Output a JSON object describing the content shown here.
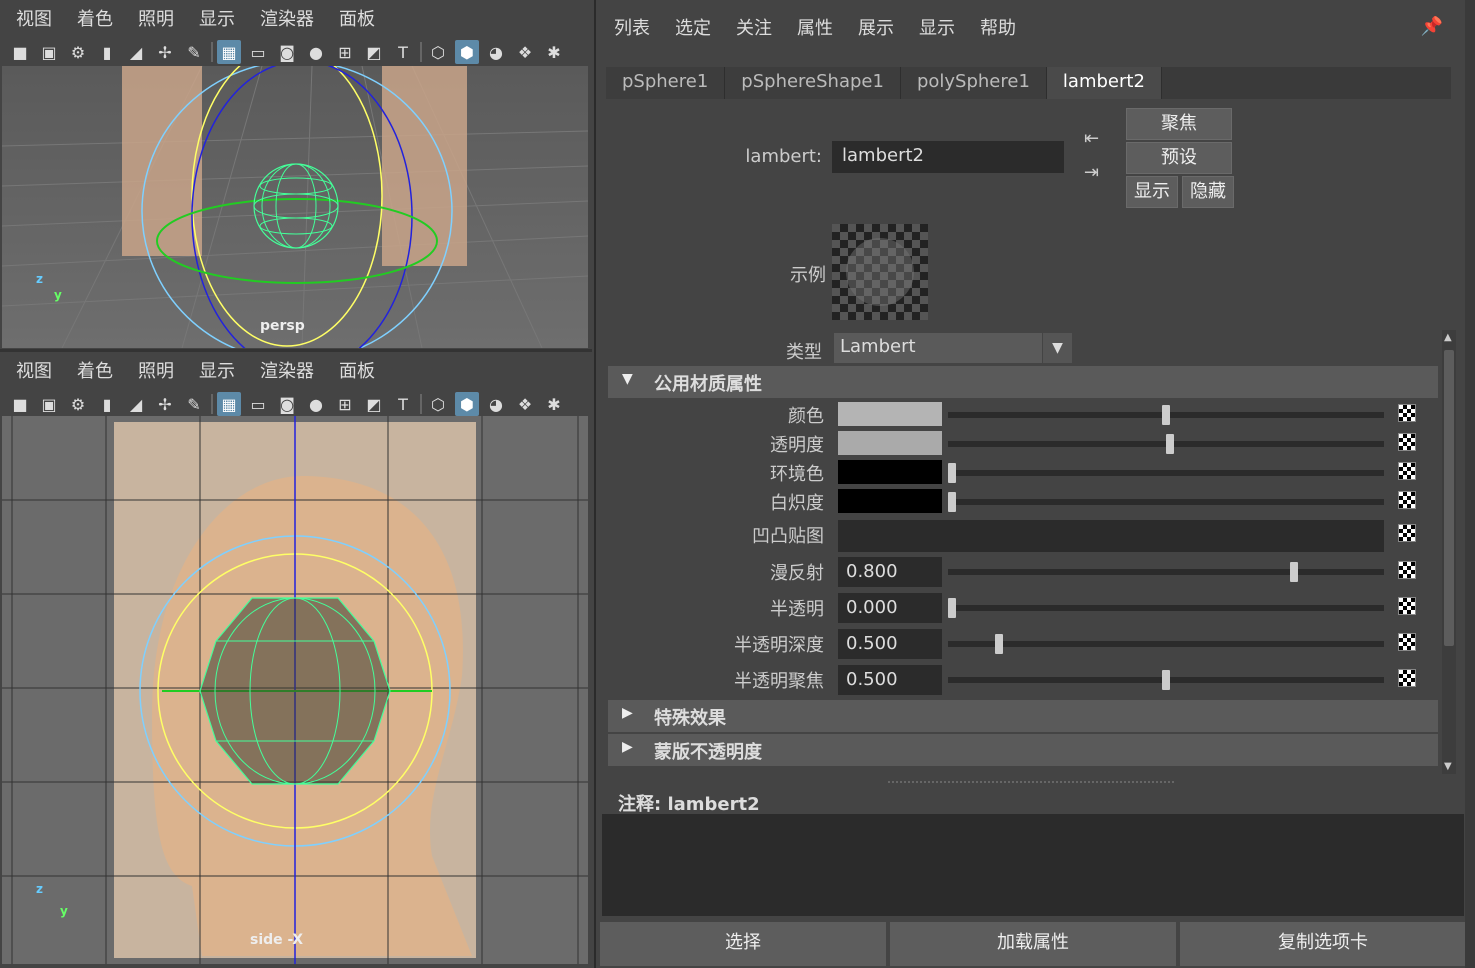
{
  "viewport_top": {
    "menu": [
      "视图",
      "着色",
      "照明",
      "显示",
      "渲染器",
      "面板"
    ],
    "camera_label": "persp",
    "axis_z": "z",
    "axis_y": "y"
  },
  "viewport_bottom": {
    "menu": [
      "视图",
      "着色",
      "照明",
      "显示",
      "渲染器",
      "面板"
    ],
    "camera_label": "side -X",
    "axis_z": "z",
    "axis_y": "y"
  },
  "attribute_editor": {
    "menu": [
      "列表",
      "选定",
      "关注",
      "属性",
      "展示",
      "显示",
      "帮助"
    ],
    "tabs": [
      "pSphere1",
      "pSphereShape1",
      "polySphere1",
      "lambert2"
    ],
    "active_tab": "lambert2",
    "name_label": "lambert:",
    "name_value": "lambert2",
    "buttons": {
      "focus": "聚焦",
      "presets": "预设",
      "show": "显示",
      "hide": "隐藏"
    },
    "sample_label": "示例",
    "type_label": "类型",
    "type_value": "Lambert",
    "sections": {
      "common": "公用材质属性",
      "special": "特殊效果",
      "matte": "蒙版不透明度"
    },
    "attributes": [
      {
        "label": "颜色",
        "swatch": "#b4b4b4",
        "slider": 0.5
      },
      {
        "label": "透明度",
        "swatch": "#aaaaaa",
        "slider": 0.51
      },
      {
        "label": "环境色",
        "swatch": "#000000",
        "slider": 0.0
      },
      {
        "label": "白炽度",
        "swatch": "#000000",
        "slider": 0.0
      },
      {
        "label": "凹凸贴图"
      },
      {
        "label": "漫反射",
        "value": "0.800",
        "slider": 0.8
      },
      {
        "label": "半透明",
        "value": "0.000",
        "slider": 0.0
      },
      {
        "label": "半透明深度",
        "value": "0.500",
        "slider": 0.11
      },
      {
        "label": "半透明聚焦",
        "value": "0.500",
        "slider": 0.5
      }
    ],
    "notes_label": "注释: lambert2",
    "bottom_buttons": [
      "选择",
      "加载属性",
      "复制选项卡"
    ]
  }
}
